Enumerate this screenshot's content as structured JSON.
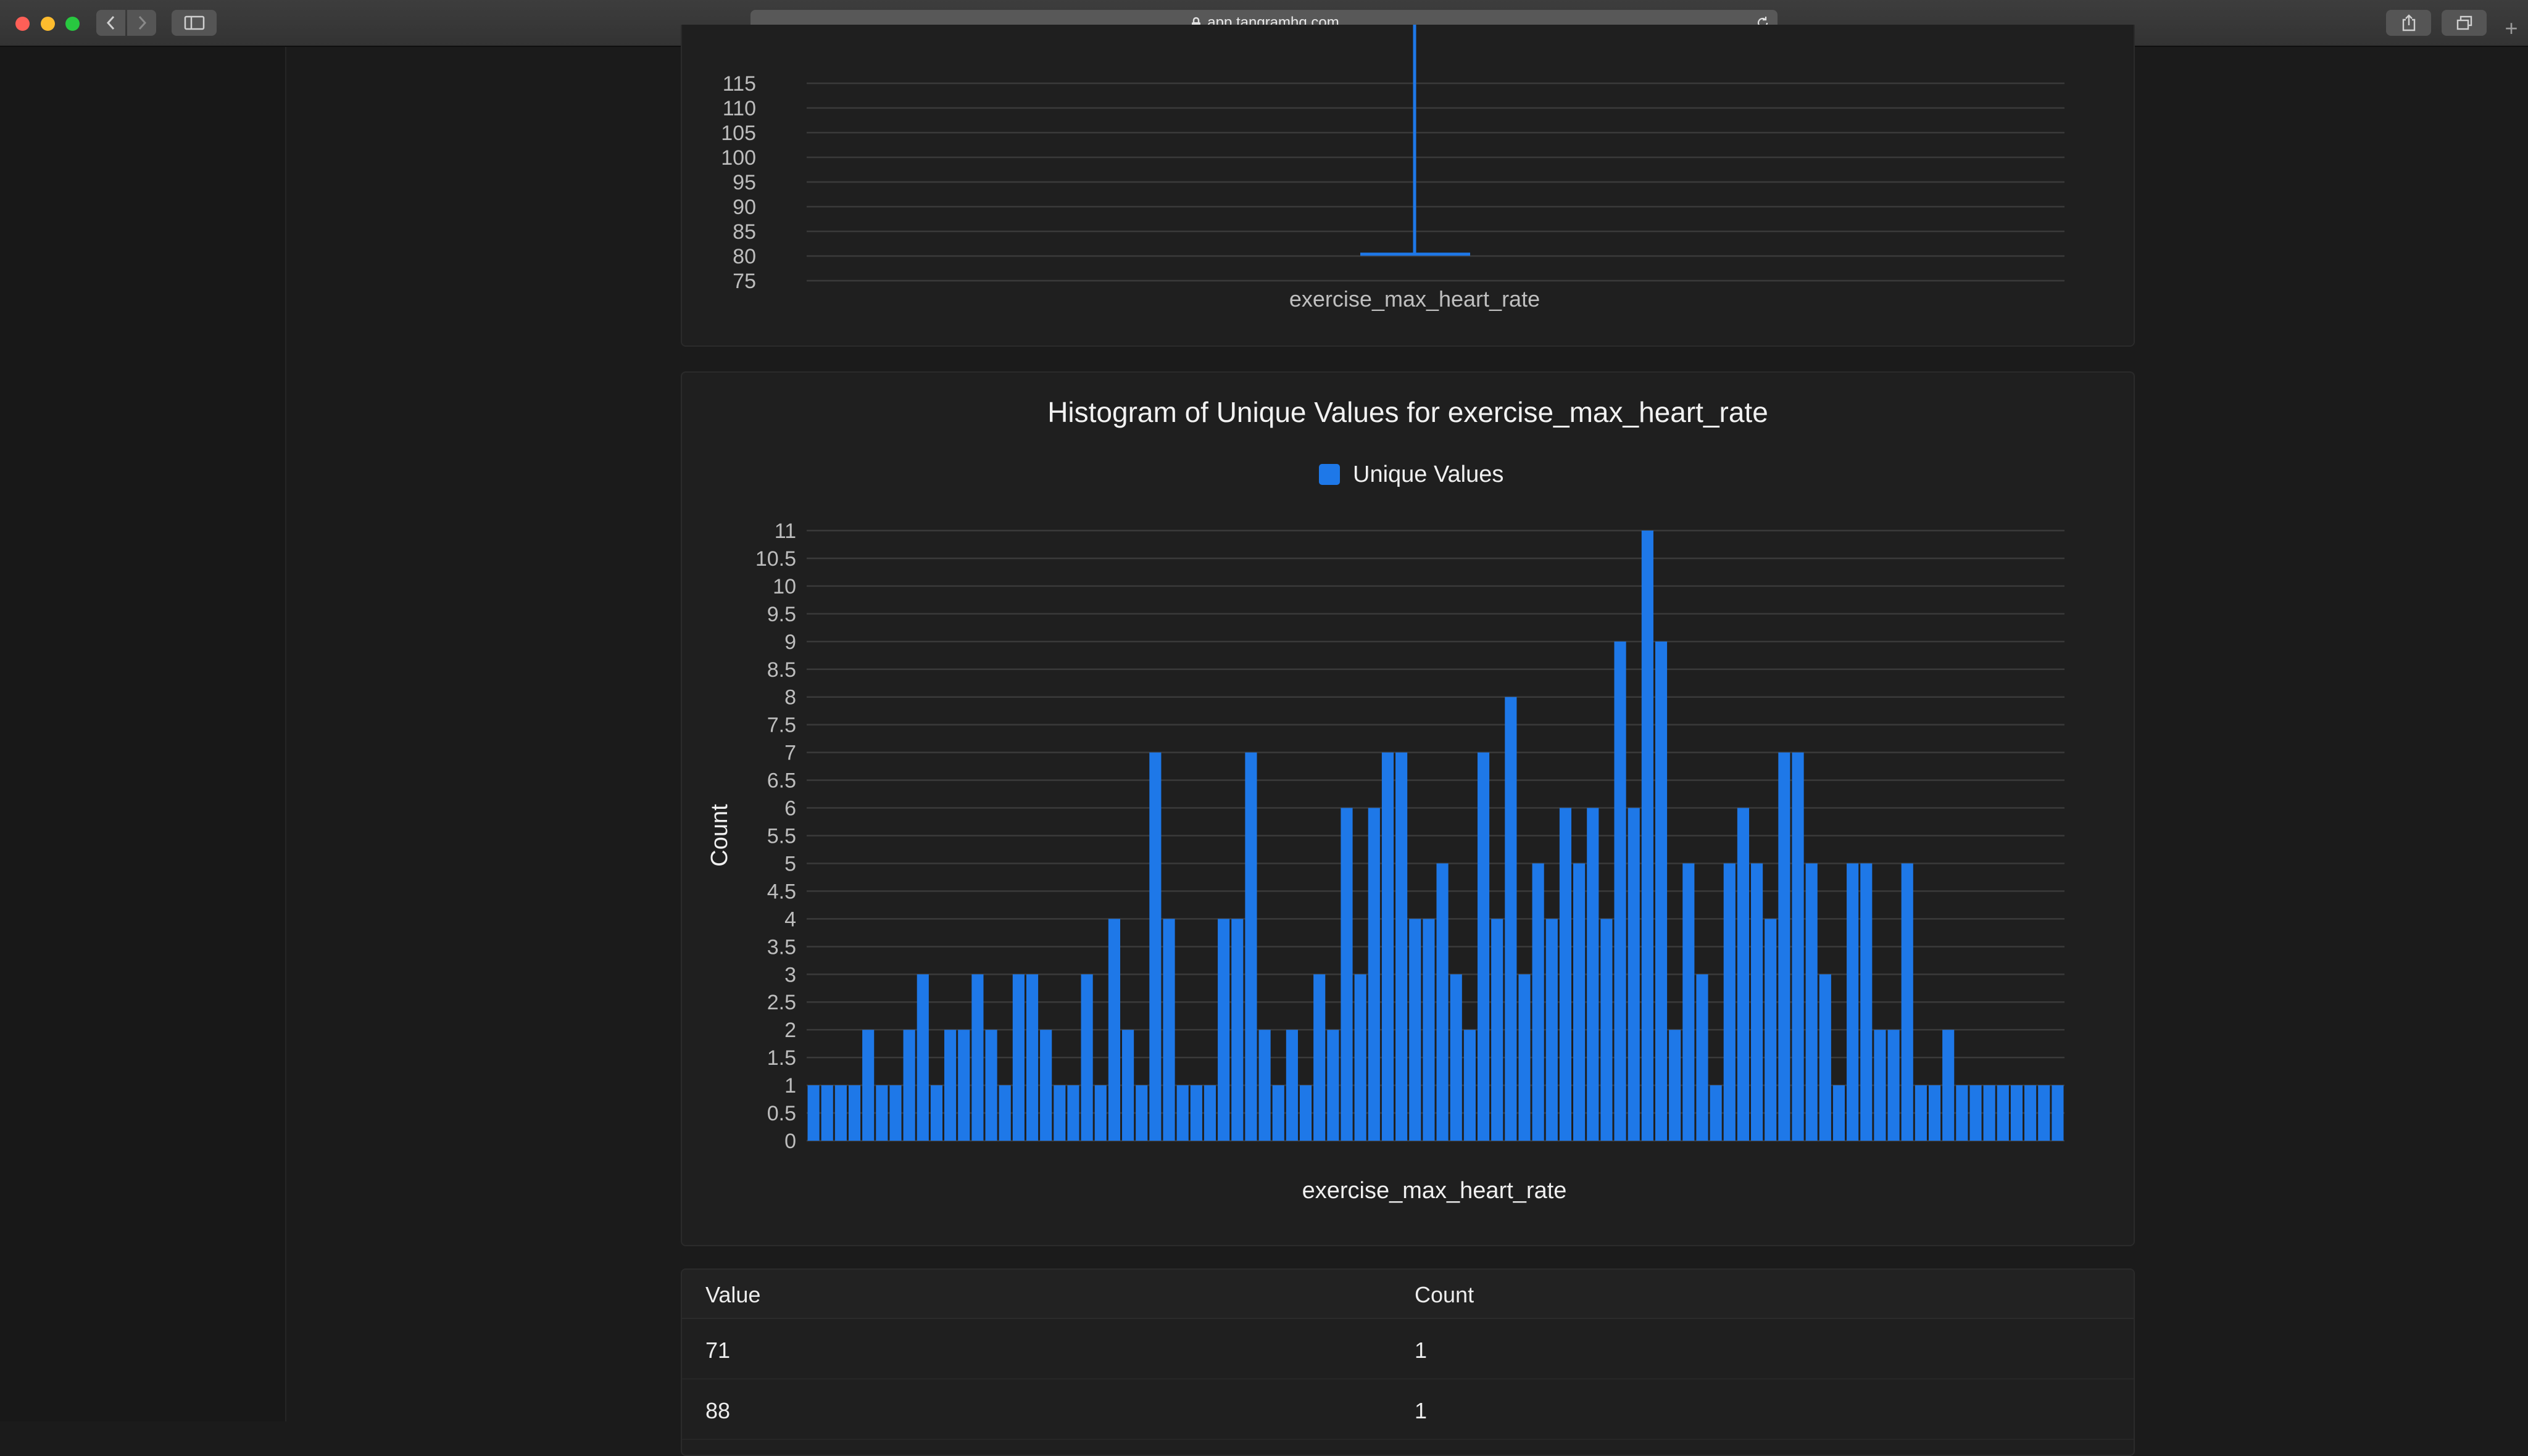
{
  "browser": {
    "url": "app.tangramhq.com",
    "icons": [
      "back-icon",
      "forward-icon",
      "sidebar-icon",
      "lock-icon",
      "reload-icon",
      "share-icon",
      "tabs-icon",
      "new-tab-icon"
    ]
  },
  "box_chart": {
    "xlabel": "exercise_max_heart_rate",
    "y_ticks": [
      "75",
      "80",
      "85",
      "90",
      "95",
      "100",
      "105",
      "110",
      "115"
    ]
  },
  "chart_data": {
    "type": "bar",
    "title": "Histogram of Unique Values for exercise_max_heart_rate",
    "legend": [
      "Unique Values"
    ],
    "xlabel": "exercise_max_heart_rate",
    "ylabel": "Count",
    "ylim": [
      0,
      11
    ],
    "y_ticks": [
      "0",
      "0.5",
      "1",
      "1.5",
      "2",
      "2.5",
      "3",
      "3.5",
      "4",
      "4.5",
      "5",
      "5.5",
      "6",
      "6.5",
      "7",
      "7.5",
      "8",
      "8.5",
      "9",
      "9.5",
      "10",
      "10.5",
      "11"
    ],
    "color": "#1e78e8",
    "series": [
      {
        "name": "Unique Values",
        "values": [
          1,
          1,
          1,
          1,
          2,
          1,
          1,
          2,
          3,
          1,
          2,
          2,
          3,
          2,
          1,
          3,
          3,
          2,
          1,
          1,
          3,
          1,
          4,
          2,
          1,
          7,
          4,
          1,
          1,
          1,
          4,
          4,
          7,
          2,
          1,
          2,
          1,
          3,
          2,
          6,
          3,
          6,
          7,
          7,
          4,
          4,
          5,
          3,
          2,
          7,
          4,
          8,
          3,
          5,
          4,
          6,
          5,
          6,
          4,
          9,
          6,
          11,
          9,
          2,
          5,
          3,
          1,
          5,
          6,
          5,
          4,
          7,
          7,
          5,
          3,
          1,
          5,
          5,
          2,
          2,
          5,
          1,
          1,
          2,
          1,
          1,
          1,
          1,
          1,
          1,
          1,
          1
        ]
      }
    ]
  },
  "table": {
    "headers": [
      "Value",
      "Count"
    ],
    "rows": [
      [
        "71",
        "1"
      ],
      [
        "88",
        "1"
      ]
    ]
  }
}
